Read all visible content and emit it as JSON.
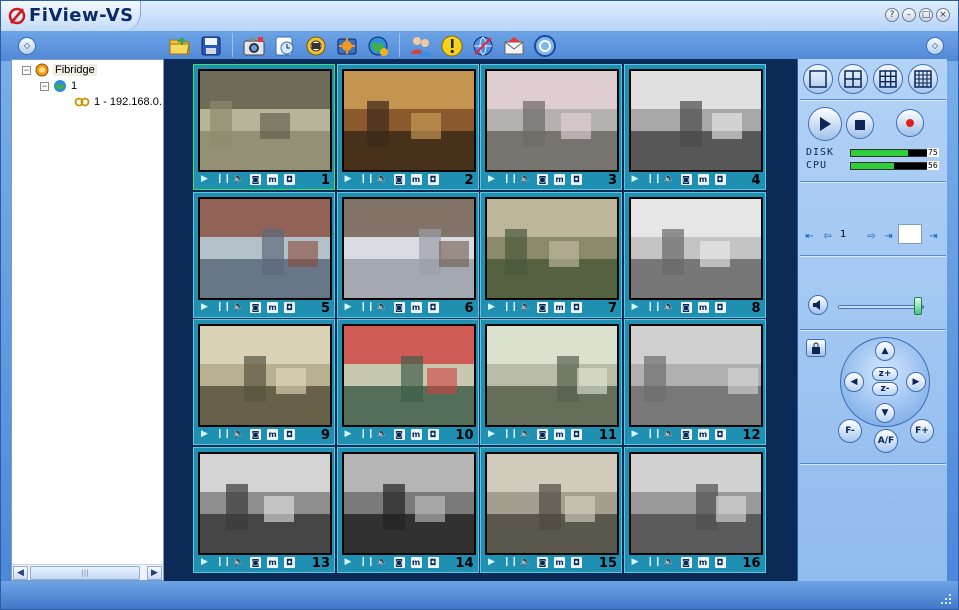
{
  "app": {
    "title": "FiView-VS"
  },
  "window_buttons": [
    "?",
    "–",
    "□",
    "×"
  ],
  "toolbar": {
    "tools": [
      {
        "icon": "open-folder-icon"
      },
      {
        "icon": "save-icon"
      },
      {
        "icon": "snapshot-icon"
      },
      {
        "icon": "record-icon"
      },
      {
        "icon": "film-icon"
      },
      {
        "icon": "settings-icon"
      },
      {
        "icon": "globe-icon"
      },
      {
        "icon": "users-icon"
      },
      {
        "icon": "alarm-icon"
      },
      {
        "icon": "network-icon"
      },
      {
        "icon": "mail-icon"
      },
      {
        "icon": "help-icon"
      }
    ]
  },
  "tree": {
    "root": "Fibridge",
    "group": "1",
    "camera": "1 - 192.168.0."
  },
  "grid": {
    "cells": [
      {
        "num": "1"
      },
      {
        "num": "2"
      },
      {
        "num": "3"
      },
      {
        "num": "4"
      },
      {
        "num": "5"
      },
      {
        "num": "6"
      },
      {
        "num": "7"
      },
      {
        "num": "8"
      },
      {
        "num": "9"
      },
      {
        "num": "10"
      },
      {
        "num": "11"
      },
      {
        "num": "12"
      },
      {
        "num": "13"
      },
      {
        "num": "14"
      },
      {
        "num": "15"
      },
      {
        "num": "16"
      }
    ],
    "controls": [
      "▶",
      "❙❙",
      "🔈",
      "◙",
      "m",
      "◘"
    ]
  },
  "right_panel": {
    "disk_label": "DISK",
    "disk_value": "75",
    "disk_percent": 75,
    "cpu_label": "CPU",
    "cpu_value": "56",
    "cpu_percent": 56,
    "page_current": "1",
    "volume_level": 0.93,
    "ptz": {
      "zoom_in": "z+",
      "zoom_out": "z-",
      "focus_minus": "F-",
      "focus_plus": "F+",
      "auto_focus": "A/F"
    }
  },
  "colors": {
    "accent": "#4a86d8",
    "grid_bg": "#0b2a55",
    "cell_bg": "#1f8fb2",
    "selected_border": "#39e06a"
  }
}
